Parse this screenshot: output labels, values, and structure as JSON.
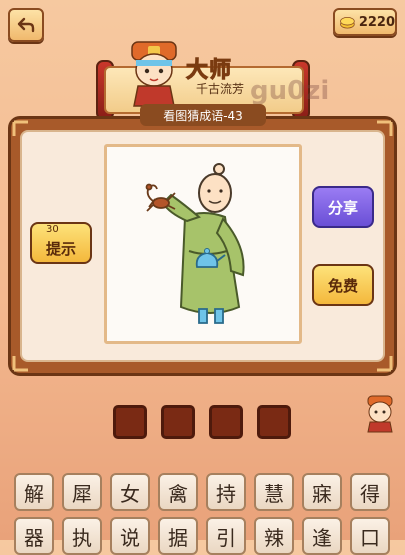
{
  "top_bar": {
    "coins": "2220"
  },
  "banner": {
    "rank_title": "大师",
    "rank_subtitle": "千古流芳",
    "watermark": "gu0zi"
  },
  "level": {
    "label": "看图猜成语-43"
  },
  "buttons": {
    "hint_label": "提示",
    "hint_cost": "30",
    "share_label": "分享",
    "free_label": "免费"
  },
  "answer_slots": 4,
  "letters": {
    "row1": [
      "解",
      "犀",
      "女",
      "禽",
      "持",
      "慧",
      "寐",
      "得"
    ],
    "row2": [
      "器",
      "执",
      "说",
      "据",
      "引",
      "辣",
      "逢",
      "口"
    ]
  },
  "colors": {
    "board": "#a85a2a",
    "accent": "#6a4fd6",
    "slot": "#7a2a14"
  }
}
